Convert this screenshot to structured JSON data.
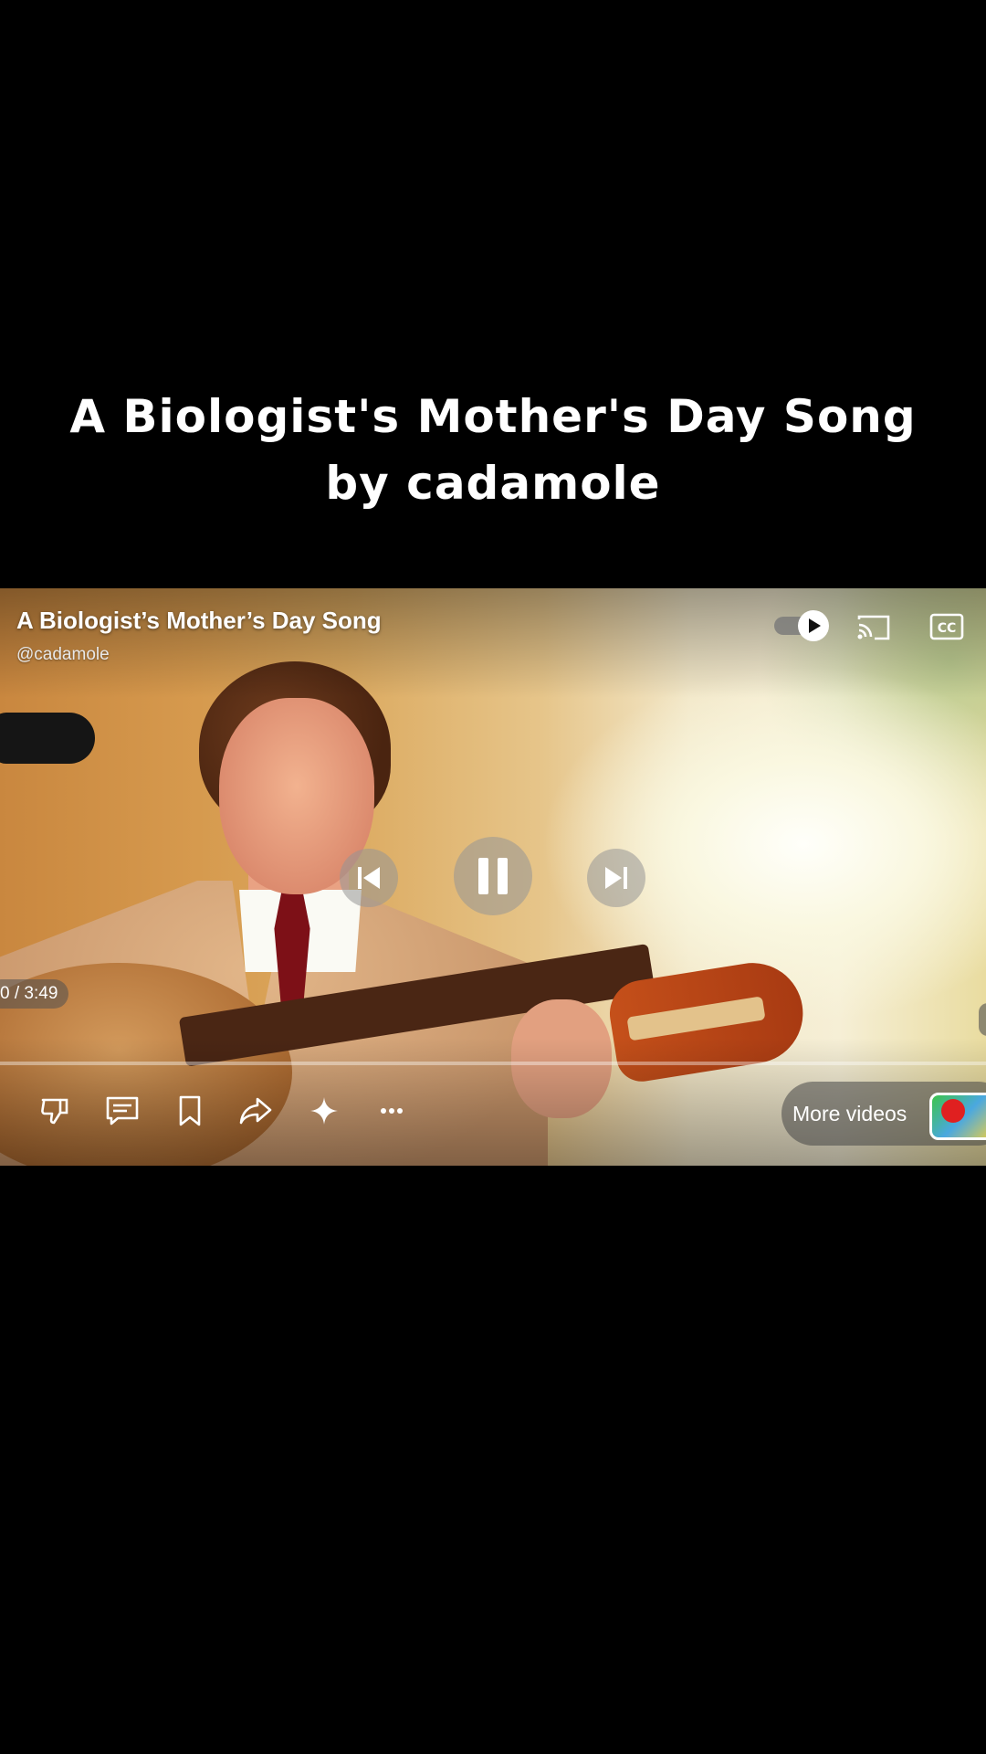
{
  "caption": {
    "line1": "A Biologist's Mother's Day Song",
    "line2": "by cadamole"
  },
  "player": {
    "title": "A Biologist’s Mother’s Day Song",
    "channel": "@cadamole",
    "time_display": "0 / 3:49",
    "progress_fraction": 0.0,
    "autoplay_on": true,
    "more_videos_label": "More videos"
  },
  "icons": {
    "autoplay": "autoplay-toggle-icon",
    "cast": "cast-icon",
    "captions": "cc-icon",
    "previous": "skip-previous-icon",
    "pause": "pause-icon",
    "next": "skip-next-icon",
    "dislike": "thumbs-down-icon",
    "comments": "comment-icon",
    "save": "bookmark-icon",
    "share": "share-icon",
    "remix": "sparkle-icon",
    "more": "more-icon"
  },
  "colors": {
    "background": "#000000",
    "progress_played": "#ff0000",
    "overlay_text": "#ffffff"
  }
}
